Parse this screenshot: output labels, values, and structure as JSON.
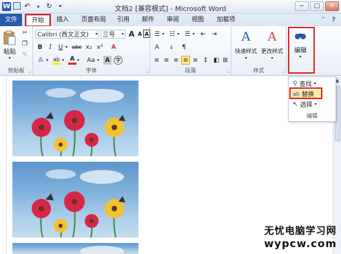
{
  "window": {
    "title": "文档2 [兼容模式] - Microsoft Word",
    "logo": "W",
    "minimize": "−",
    "restore": "□",
    "close": "✕"
  },
  "tabs": [
    {
      "label": "文件"
    },
    {
      "label": "开始"
    },
    {
      "label": "插入"
    },
    {
      "label": "页面布局"
    },
    {
      "label": "引用"
    },
    {
      "label": "邮件"
    },
    {
      "label": "审阅"
    },
    {
      "label": "视图"
    },
    {
      "label": "加载项"
    }
  ],
  "ribbon": {
    "clipboard": {
      "label": "剪贴板",
      "paste": "粘贴"
    },
    "font": {
      "label": "字体",
      "name": "Calibri (西文正文)",
      "size": "三号",
      "bold": "B",
      "italic": "I",
      "underline": "U",
      "strike": "abc",
      "sub": "x₂",
      "sup": "x²",
      "grow": "A",
      "shrink": "A",
      "case": "Aa",
      "clear": "A",
      "color": "A",
      "char_border": "A"
    },
    "paragraph": {
      "label": "段落"
    },
    "styles": {
      "label": "样式",
      "quick": "快速样式",
      "change": "更改样式"
    },
    "editing": {
      "label": "编辑"
    }
  },
  "edit_menu": {
    "find": "查找",
    "replace": "替换",
    "select": "选择",
    "label": "编辑"
  },
  "watermark": {
    "line1": "无忧电脑学习网",
    "line2": "wypcw.com"
  },
  "colors": {
    "accent": "#2b5aa8",
    "highlight": "#e02424"
  }
}
